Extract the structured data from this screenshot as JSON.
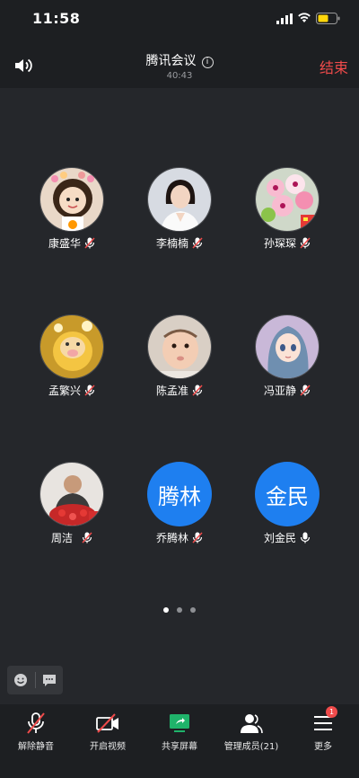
{
  "status_bar": {
    "time": "11:58"
  },
  "header": {
    "title": "腾讯会议",
    "info_glyph": "i",
    "timer": "40:43",
    "end_label": "结束"
  },
  "participants": [
    {
      "name": "康盛华",
      "avatar_type": "photo",
      "mic": "muted"
    },
    {
      "name": "李楠楠",
      "avatar_type": "photo",
      "mic": "muted"
    },
    {
      "name": "孙琛琛",
      "avatar_type": "photo",
      "mic": "muted"
    },
    {
      "name": "孟繁兴",
      "avatar_type": "photo",
      "mic": "muted"
    },
    {
      "name": "陈孟准",
      "avatar_type": "photo",
      "mic": "muted"
    },
    {
      "name": "冯亚静",
      "avatar_type": "photo",
      "mic": "muted"
    },
    {
      "name": "周洁",
      "avatar_type": "photo",
      "mic": "muted"
    },
    {
      "name": "乔腾林",
      "avatar_type": "initials",
      "initials": "腾林",
      "mic": "muted"
    },
    {
      "name": "刘金民",
      "avatar_type": "initials",
      "initials": "金民",
      "mic": "on"
    }
  ],
  "pagination": {
    "pages": 3,
    "current": 1
  },
  "toolbar": {
    "items": [
      {
        "label": "解除静音",
        "icon": "mic-muted-icon"
      },
      {
        "label": "开启视频",
        "icon": "video-off-icon"
      },
      {
        "label": "共享屏幕",
        "icon": "share-screen-icon"
      },
      {
        "label": "管理成员(21)",
        "icon": "members-icon"
      },
      {
        "label": "更多",
        "icon": "more-menu-icon"
      }
    ],
    "more_badge": "1"
  },
  "colors": {
    "accent_blue": "#1e7ff0",
    "end_red": "#f04b4b",
    "share_green": "#1fb36a",
    "background": "#25272b"
  }
}
